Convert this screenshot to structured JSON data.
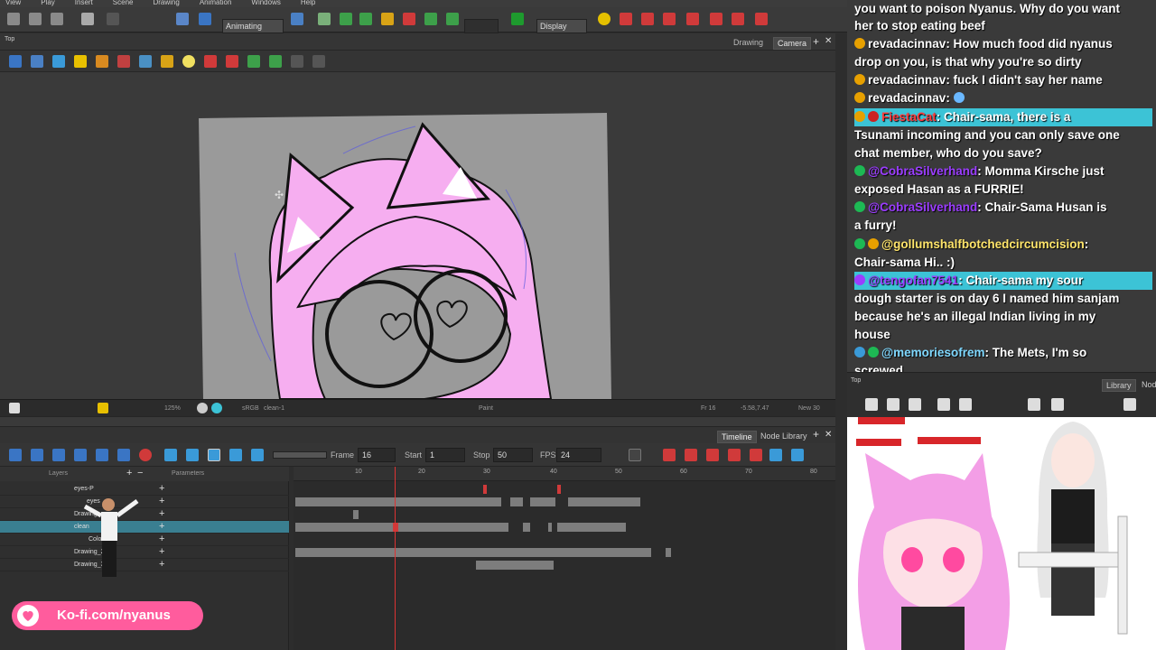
{
  "app": {
    "menu": [
      "View",
      "Play",
      "Insert",
      "Scene",
      "Drawing",
      "Animation",
      "Windows",
      "Help"
    ],
    "mode": "Animating",
    "display": "Display",
    "view_label": "Top",
    "view_tabs": [
      "Drawing",
      "Camera"
    ],
    "status": {
      "zoom": "125%",
      "color_mode": "sRGB",
      "layer": "clean-1",
      "tool": "Paint",
      "frame": "Fr 16",
      "coords": "-5.58,7.47",
      "extra": "New 30"
    }
  },
  "timeline": {
    "tabs": [
      "Timeline",
      "Node Library"
    ],
    "frame_label": "Frame",
    "frame": "16",
    "start_label": "Start",
    "start": "1",
    "stop_label": "Stop",
    "stop": "50",
    "fps_label": "FPS",
    "fps": "24",
    "layers_header": "Layers",
    "params_header": "Parameters",
    "ruler": [
      "10",
      "20",
      "30",
      "40",
      "50",
      "60",
      "70",
      "80"
    ],
    "layers": [
      {
        "name": "eyes-P",
        "selected": false
      },
      {
        "name": "eyes",
        "selected": false
      },
      {
        "name": "Drawing",
        "selected": false
      },
      {
        "name": "clean",
        "selected": true
      },
      {
        "name": "Color-2",
        "selected": false
      },
      {
        "name": "Drawing_2",
        "selected": false
      },
      {
        "name": "Drawing_3",
        "selected": false
      }
    ]
  },
  "kofi": {
    "text": "Ko-fi.com/nyanus"
  },
  "chat": {
    "lines": [
      {
        "user": "",
        "text": "you want to poison Nyanus. Why do you want"
      },
      {
        "user": "",
        "text": "her to stop eating beef"
      },
      {
        "user": "revadacinnav",
        "text": ": How much food did nyanus"
      },
      {
        "user": "",
        "text": "drop on you, is that why you're so dirty"
      },
      {
        "user": "revadacinnav",
        "text": ": fuck I didn't say her name"
      },
      {
        "user": "revadacinnav",
        "text": ":"
      },
      {
        "user": "FiestaCat",
        "text": ": Chair-sama, there is a",
        "highlight": true
      },
      {
        "user": "",
        "text": "Tsunami incoming and you can only save one"
      },
      {
        "user": "",
        "text": "chat member, who do you save?"
      },
      {
        "user": "@CobraSilverhand",
        "text": ": Momma Kirsche just"
      },
      {
        "user": "",
        "text": "exposed Hasan as a FURRIE!"
      },
      {
        "user": "@CobraSilverhand",
        "text": ": Chair-Sama Husan is"
      },
      {
        "user": "",
        "text": "a furry!"
      },
      {
        "user": "@gollumshalfbotchedcircumcision",
        "text": ":"
      },
      {
        "user": "",
        "text": "Chair-sama Hi.. :)"
      },
      {
        "user": "@tengofan7541",
        "text": ": Chair-sama my sour",
        "highlight": true
      },
      {
        "user": "",
        "text": "dough starter is on day 6 I named him sanjam"
      },
      {
        "user": "",
        "text": "because he's an illegal Indian living in my"
      },
      {
        "user": "",
        "text": "house"
      },
      {
        "user": "@memoriesofrem",
        "text": ": The Mets, I'm so"
      },
      {
        "user": "",
        "text": "screwed"
      }
    ]
  },
  "right_panel": {
    "label": "Top",
    "tabs": [
      "Library",
      "Node"
    ]
  },
  "colors": {
    "accent": "#3cc3d6",
    "pink": "#ff5c9d",
    "character_pink": "#fbb0f0"
  }
}
